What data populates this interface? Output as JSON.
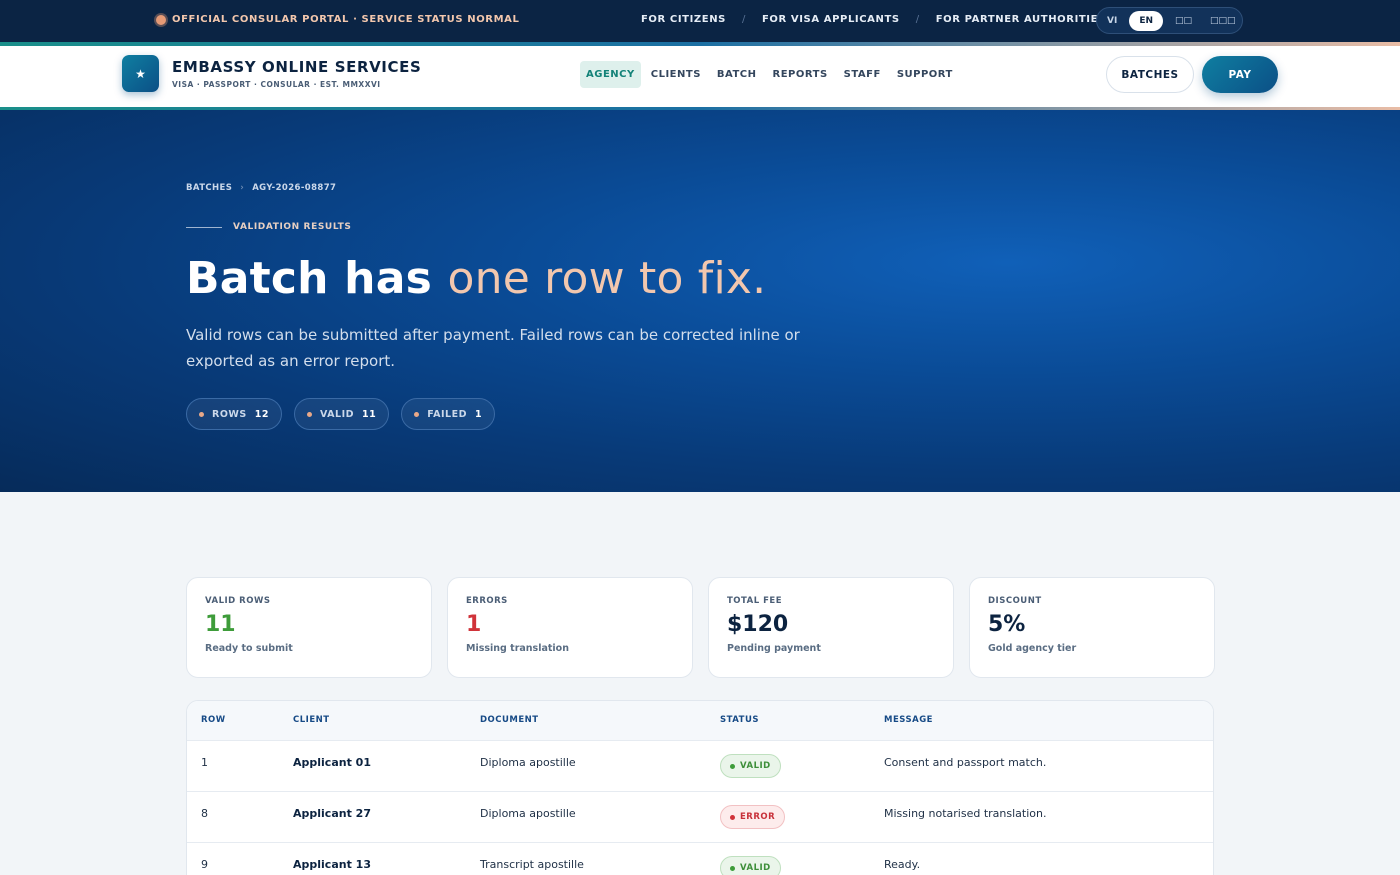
{
  "utility": {
    "status": "OFFICIAL CONSULAR PORTAL · SERVICE STATUS NORMAL",
    "links": [
      "FOR CITIZENS",
      "FOR VISA APPLICANTS",
      "FOR PARTNER AUTHORITIES"
    ],
    "separator": "/",
    "languages": [
      "VI",
      "EN",
      "□□",
      "□□□"
    ],
    "active_language": "EN"
  },
  "header": {
    "logo_glyph": "★",
    "brand_title": "EMBASSY ONLINE SERVICES",
    "brand_sub": "VISA · PASSPORT · CONSULAR · EST. MMXXVI",
    "nav": [
      "AGENCY",
      "CLIENTS",
      "BATCH",
      "REPORTS",
      "STAFF",
      "SUPPORT"
    ],
    "active_nav": "AGENCY",
    "batches_button": "BATCHES",
    "pay_button": "PAY"
  },
  "hero": {
    "breadcrumb": [
      "BATCHES",
      "AGY-2026-08877"
    ],
    "breadcrumb_separator": "›",
    "eyebrow": "VALIDATION RESULTS",
    "title_main": "Batch has ",
    "title_accent": "one row to fix.",
    "description": "Valid rows can be submitted after payment. Failed rows can be corrected inline or exported as an error report.",
    "chips": [
      {
        "label": "ROWS",
        "value": "12"
      },
      {
        "label": "VALID",
        "value": "11"
      },
      {
        "label": "FAILED",
        "value": "1"
      }
    ]
  },
  "stats": [
    {
      "label": "VALID ROWS",
      "value": "11",
      "note": "Ready to submit",
      "tone": "green"
    },
    {
      "label": "ERRORS",
      "value": "1",
      "note": "Missing translation",
      "tone": "red"
    },
    {
      "label": "TOTAL FEE",
      "value": "$120",
      "note": "Pending payment",
      "tone": "default"
    },
    {
      "label": "DISCOUNT",
      "value": "5%",
      "note": "Gold agency tier",
      "tone": "default"
    }
  ],
  "table": {
    "headers": [
      "ROW",
      "CLIENT",
      "DOCUMENT",
      "STATUS",
      "MESSAGE"
    ],
    "rows": [
      {
        "row": "1",
        "client": "Applicant 01",
        "document": "Diploma apostille",
        "status": "VALID",
        "message": "Consent and passport match."
      },
      {
        "row": "8",
        "client": "Applicant 27",
        "document": "Diploma apostille",
        "status": "ERROR",
        "message": "Missing notarised translation."
      },
      {
        "row": "9",
        "client": "Applicant 13",
        "document": "Transcript apostille",
        "status": "VALID",
        "message": "Ready."
      }
    ]
  },
  "colors": {
    "navy": "#0b2444",
    "accent_teal": "#138278",
    "accent_peach": "#f2c7ae",
    "valid_green": "#3e9c3a",
    "error_red": "#d0333a"
  }
}
